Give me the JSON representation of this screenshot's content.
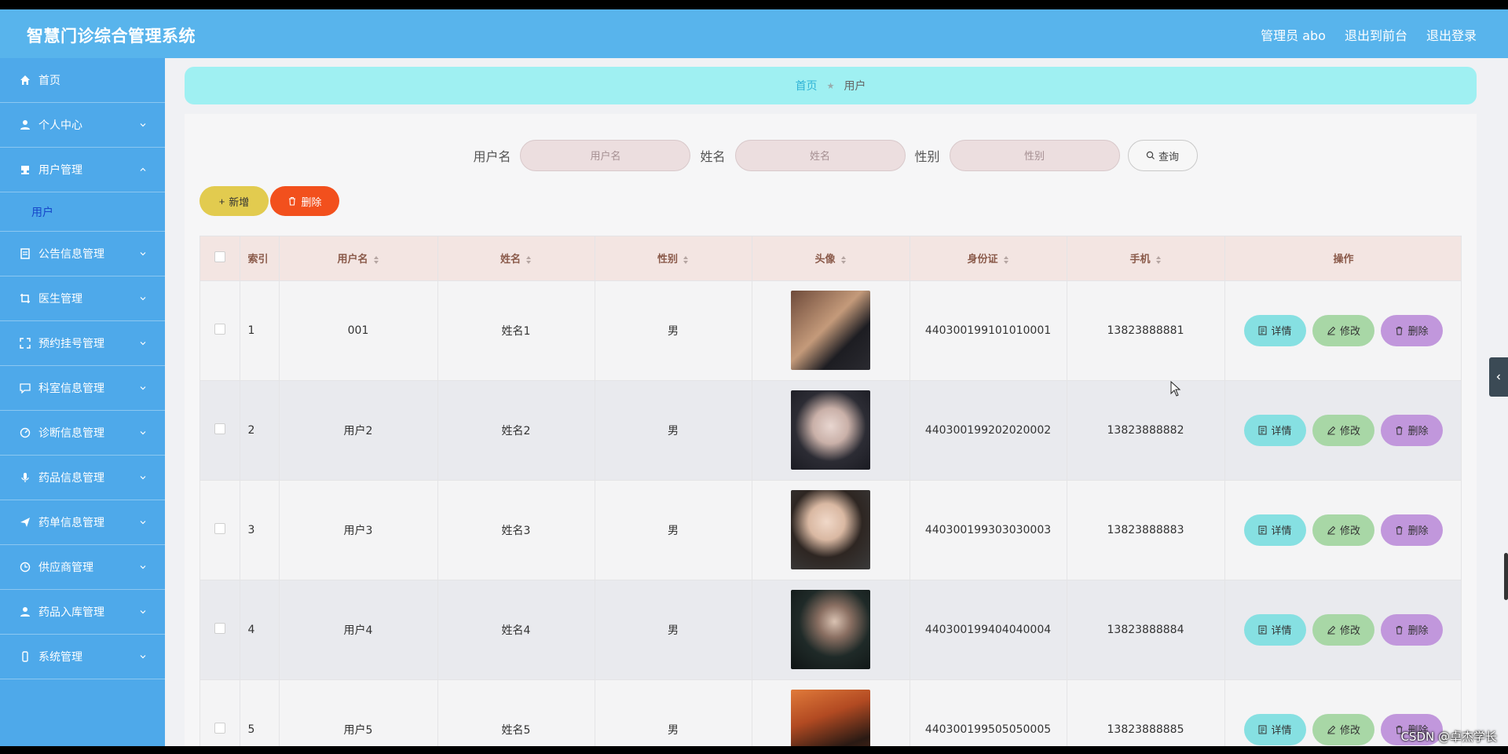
{
  "header": {
    "title": "智慧门诊综合管理系统",
    "admin": "管理员 abo",
    "to_front": "退出到前台",
    "logout": "退出登录"
  },
  "sidebar": {
    "items": [
      {
        "label": "首页",
        "icon": "home-icon"
      },
      {
        "label": "个人中心",
        "icon": "user-icon"
      },
      {
        "label": "用户管理",
        "icon": "stamp-icon",
        "expanded": true,
        "sub": "用户"
      },
      {
        "label": "公告信息管理",
        "icon": "document-icon"
      },
      {
        "label": "医生管理",
        "icon": "crop-icon"
      },
      {
        "label": "预约挂号管理",
        "icon": "fullscreen-icon"
      },
      {
        "label": "科室信息管理",
        "icon": "chat-icon"
      },
      {
        "label": "诊断信息管理",
        "icon": "gauge-icon"
      },
      {
        "label": "药品信息管理",
        "icon": "microphone-icon"
      },
      {
        "label": "药单信息管理",
        "icon": "send-icon"
      },
      {
        "label": "供应商管理",
        "icon": "clock-icon"
      },
      {
        "label": "药品入库管理",
        "icon": "user-icon"
      },
      {
        "label": "系统管理",
        "icon": "phone-icon"
      }
    ]
  },
  "breadcrumb": {
    "home": "首页",
    "current": "用户"
  },
  "search": {
    "username_label": "用户名",
    "username_placeholder": "用户名",
    "name_label": "姓名",
    "name_placeholder": "姓名",
    "gender_label": "性别",
    "gender_placeholder": "性别",
    "query_label": "查询"
  },
  "actions": {
    "add_label": "新增",
    "delete_label": "删除"
  },
  "table": {
    "headers": {
      "index": "索引",
      "username": "用户名",
      "name": "姓名",
      "gender": "性别",
      "avatar": "头像",
      "id_card": "身份证",
      "phone": "手机",
      "ops": "操作"
    },
    "op_labels": {
      "detail": "详情",
      "edit": "修改",
      "delete": "删除"
    },
    "rows": [
      {
        "index": "1",
        "username": "001",
        "name": "姓名1",
        "gender": "男",
        "id_card": "440300199101010001",
        "phone": "13823888881"
      },
      {
        "index": "2",
        "username": "用户2",
        "name": "姓名2",
        "gender": "男",
        "id_card": "440300199202020002",
        "phone": "13823888882"
      },
      {
        "index": "3",
        "username": "用户3",
        "name": "姓名3",
        "gender": "男",
        "id_card": "440300199303030003",
        "phone": "13823888883"
      },
      {
        "index": "4",
        "username": "用户4",
        "name": "姓名4",
        "gender": "男",
        "id_card": "440300199404040004",
        "phone": "13823888884"
      },
      {
        "index": "5",
        "username": "用户5",
        "name": "姓名5",
        "gender": "男",
        "id_card": "440300199505050005",
        "phone": "13823888885"
      }
    ]
  },
  "watermark": "CSDN @卓杰学长",
  "colors": {
    "header": "#58b4ec",
    "sidebar": "#4ea9ea",
    "breadcrumb": "#9ff0f2",
    "add": "#e2cb4f",
    "delete": "#f2501d",
    "detail": "#86e0e2",
    "edit": "#a8d7a6",
    "row_delete": "#c197dc"
  }
}
